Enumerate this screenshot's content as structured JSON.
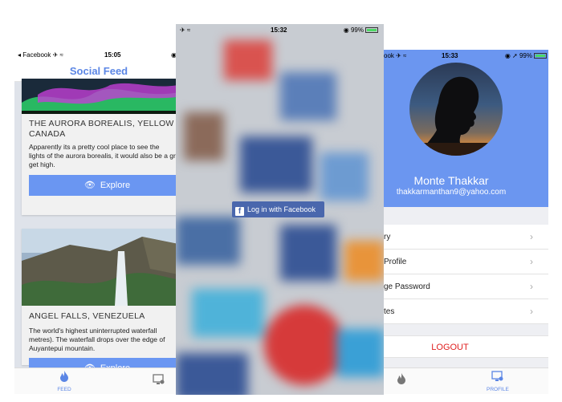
{
  "feed_screen": {
    "status": {
      "carrier": "◂ Facebook ✈ ≈",
      "time": "15:05",
      "right": "◉"
    },
    "title": "Social Feed",
    "cards": [
      {
        "title": "THE AURORA BOREALIS, YELLOW KI",
        "title_line2": "CANADA",
        "desc_lines": [
          "Apparently its a pretty cool place to see the",
          "lights of the aurora borealis, it would also be a great place",
          "get high."
        ],
        "button": "Explore"
      },
      {
        "title": "ANGEL FALLS, VENEZUELA",
        "desc_lines": [
          "The world's highest uninterrupted waterfall",
          "metres). The waterfall drops over the edge of",
          "Auyantepui mountain."
        ],
        "button": "Explore"
      }
    ],
    "tabs": {
      "feed": "FEED"
    }
  },
  "login_screen": {
    "status": {
      "left": "✈ ≈",
      "time": "15:32",
      "battery": "99%"
    },
    "login_button": "Log in with Facebook"
  },
  "profile_screen": {
    "status": {
      "left": "ook ✈ ≈",
      "time": "15:33",
      "battery": "99%"
    },
    "name": "Monte Thakkar",
    "email": "thakkarmanthan9@yahoo.com",
    "menu": [
      "ry",
      "Profile",
      "ge Password",
      "tes"
    ],
    "logout": "LOGOUT",
    "tabs": {
      "profile": "PROFILE"
    }
  },
  "colors": {
    "accent": "#6a96f2",
    "facebook": "#4a67ad",
    "logout": "#e02020"
  }
}
